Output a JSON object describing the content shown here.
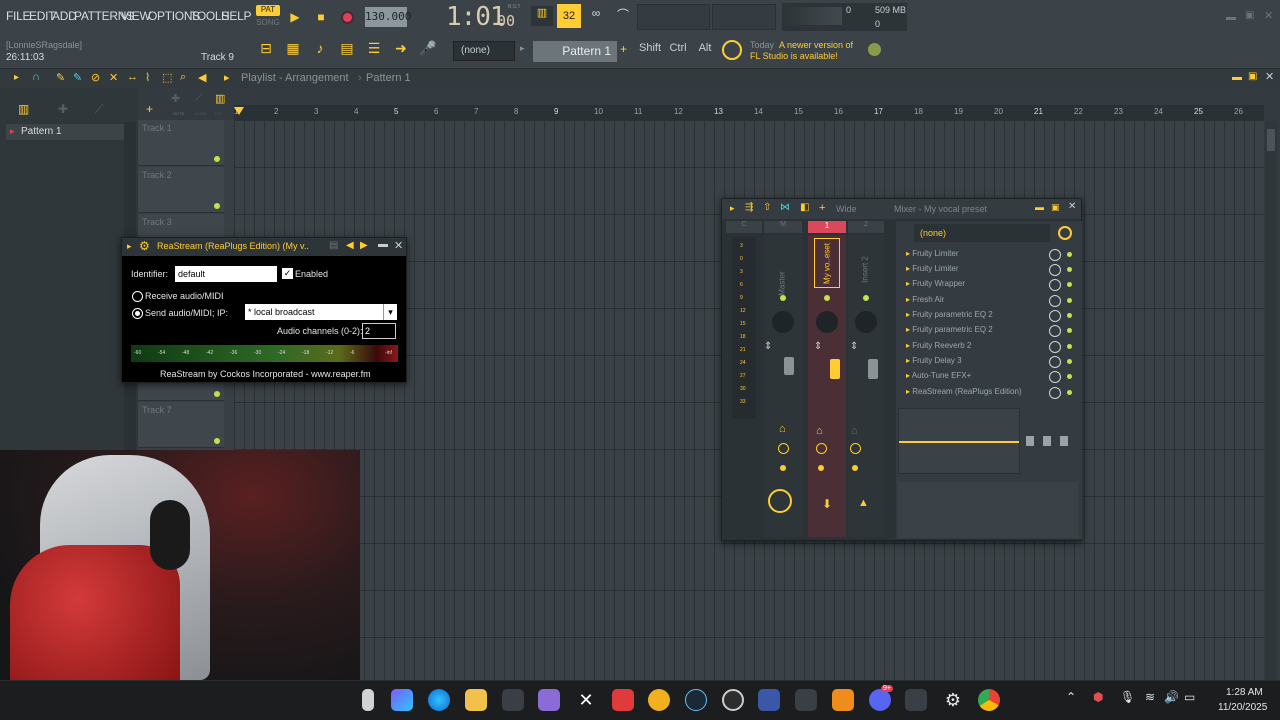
{
  "menu": [
    "FILE",
    "EDIT",
    "ADD",
    "PATTERNS",
    "VIEW",
    "OPTIONS",
    "TOOLS",
    "HELP"
  ],
  "transport": {
    "pat": "PAT",
    "song": "SONG",
    "tempo": "130.000",
    "time": "1:01",
    "time_sub": "00",
    "bst": "B:S:T"
  },
  "memory": {
    "cpu": "0",
    "mem": "509 MB",
    "poly": "0"
  },
  "hint": {
    "user": "[LonnieSRagsdale]",
    "clock": "26:11:03",
    "track": "Track 9"
  },
  "preset_none": "(none)",
  "pattern_selector": "Pattern 1",
  "keys": {
    "shift": "Shift",
    "ctrl": "Ctrl",
    "alt": "Alt"
  },
  "news": {
    "today": "Today",
    "line1": "A newer version of",
    "line2": "FL Studio is available!"
  },
  "playlist": {
    "title": "Playlist - Arrangement",
    "crumb": "Pattern 1",
    "pattern_item": "Pattern 1",
    "tracks": [
      "Track 1",
      "Track 2",
      "Track 3",
      "Track 7"
    ],
    "ruler": [
      "1",
      "2",
      "3",
      "4",
      "5",
      "6",
      "7",
      "8",
      "9",
      "10",
      "11",
      "12",
      "13",
      "14",
      "15",
      "16",
      "17",
      "18",
      "19",
      "20",
      "21",
      "22",
      "23",
      "24",
      "25",
      "26"
    ],
    "plus_labels": [
      "NOTE",
      "CHAN",
      "PAT"
    ]
  },
  "reastream": {
    "title": "ReaStream (ReaPlugs Edition) (My v..",
    "identifier_label": "Identifier:",
    "identifier": "default",
    "enabled": "Enabled",
    "receive": "Receive audio/MIDI",
    "send": "Send audio/MIDI; IP:",
    "ip": "* local broadcast",
    "channels_label": "Audio channels (0-2):",
    "channels": "2",
    "scale": [
      "-60",
      "-54",
      "-48",
      "-42",
      "-36",
      "-30",
      "-24",
      "-18",
      "-12",
      "-6",
      "-inf"
    ],
    "footer": "ReaStream by Cockos Incorporated - www.reaper.fm"
  },
  "mixer": {
    "title": "Mixer - My vocal preset",
    "wide": "Wide",
    "preset": "(none)",
    "strips": {
      "c": "C",
      "m": "M",
      "one": "1",
      "two": "2",
      "master": "Master",
      "myvo": "My vo..eset",
      "insert2": "Insert 2"
    },
    "meter_marks": [
      "3",
      "0",
      "3",
      "6",
      "9",
      "12",
      "15",
      "18",
      "21",
      "24",
      "27",
      "30",
      "33"
    ],
    "fx": [
      "Fruity Limiter",
      "Fruity Limiter",
      "Fruity Wrapper",
      "Fresh Air",
      "Fruity parametric EQ 2",
      "Fruity parametric EQ 2",
      "Fruity Reeverb 2",
      "Fruity Delay 3",
      "Auto-Tune EFX+",
      "ReaStream (ReaPlugs Edition)"
    ]
  },
  "taskbar": {
    "time": "1:28 AM",
    "date": "11/20/2025",
    "discord_badge": "9+"
  },
  "colors": {
    "accent": "#ffcc33",
    "selected_insert": "#d9485b",
    "fx_dot": "#c8e04a"
  }
}
